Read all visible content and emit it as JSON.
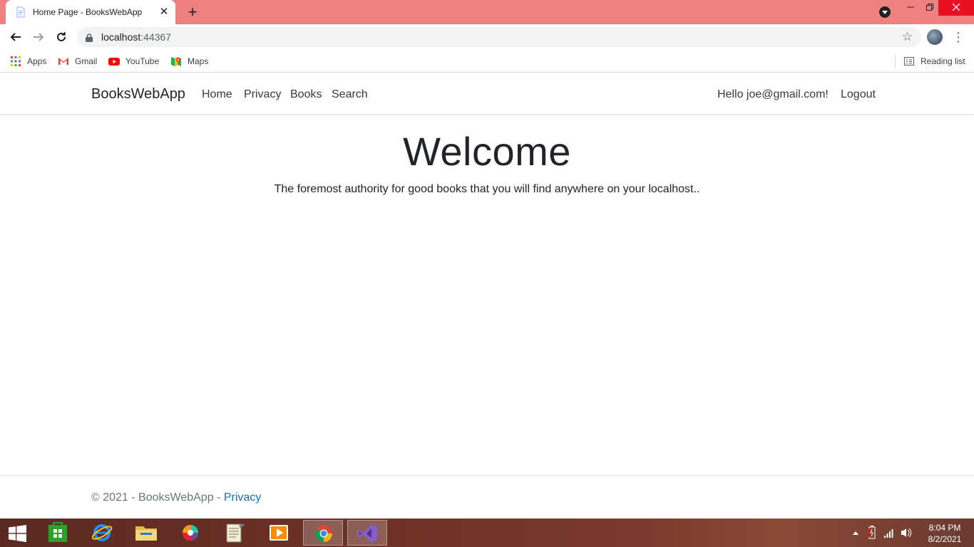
{
  "browser": {
    "tab_title": "Home Page - BooksWebApp",
    "tab_close_glyph": "✕",
    "new_tab_glyph": "+",
    "url_host": "localhost",
    "url_port": ":44367",
    "bookmarks": [
      {
        "label": "Apps",
        "icon": "apps-grid-icon"
      },
      {
        "label": "Gmail",
        "icon": "gmail-icon"
      },
      {
        "label": "YouTube",
        "icon": "youtube-icon"
      },
      {
        "label": "Maps",
        "icon": "maps-icon"
      }
    ],
    "reading_list": "Reading list",
    "tabstrip_color": "#f08080"
  },
  "site": {
    "brand": "BooksWebApp",
    "nav": {
      "home": "Home",
      "privacy": "Privacy",
      "books": "Books",
      "search": "Search"
    },
    "user_greeting": "Hello joe@gmail.com!",
    "logout": "Logout"
  },
  "main": {
    "title": "Welcome",
    "lead": "The foremost authority for good books that you will find anywhere on your localhost.."
  },
  "footer": {
    "copyright": "© 2021 - BooksWebApp - ",
    "privacy_link": "Privacy",
    "link_color": "#1b6ec2"
  },
  "taskbar": {
    "time": "8:04 PM",
    "date": "8/2/2021",
    "apps": [
      "windows-store-icon",
      "internet-explorer-icon",
      "file-explorer-icon",
      "color-app-icon",
      "notepad-icon",
      "media-player-icon",
      "chrome-icon",
      "visual-studio-icon"
    ]
  }
}
